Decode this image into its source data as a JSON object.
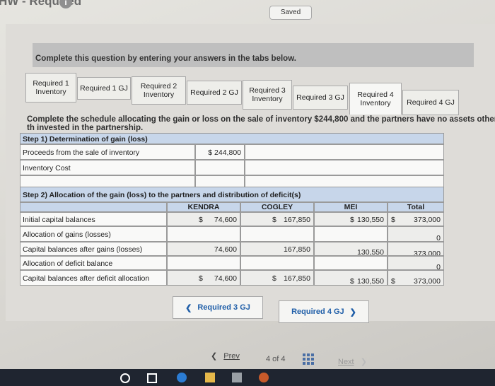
{
  "header": {
    "title": "HW - Required",
    "info_icon": "info-icon",
    "saved": "Saved"
  },
  "instruction": "Complete this question by entering your answers in the tabs below.",
  "tabs": [
    {
      "label": "Required 1 Inventory"
    },
    {
      "label": "Required 1 GJ"
    },
    {
      "label": "Required 2 Inventory"
    },
    {
      "label": "Required 2 GJ"
    },
    {
      "label": "Required 3 Inventory"
    },
    {
      "label": "Required 3 GJ"
    },
    {
      "label": "Required 4 Inventory"
    },
    {
      "label": "Required 4 GJ"
    }
  ],
  "schedule_text": "Complete the schedule allocating the gain or loss on the sale of inventory $244,800 and the partners have no assets other th invested in the partnership.",
  "step1": {
    "title": "Step 1) Determination of gain (loss)",
    "proceeds_label": "Proceeds from the sale of inventory",
    "proceeds_value": "$ 244,800",
    "inventory_cost_label": "Inventory Cost"
  },
  "step2": {
    "title": "Step 2) Allocation of the gain (loss) to the partners and distribution of deficit(s)",
    "columns": [
      "KENDRA",
      "COGLEY",
      "MEI",
      "Total"
    ],
    "rows": [
      {
        "label": "Initial capital balances",
        "kendra_cur": "$",
        "kendra": "74,600",
        "cogley_cur": "$",
        "cogley": "167,850",
        "mei_cur": "$",
        "mei": "130,550",
        "total_cur": "$",
        "total": "373,000"
      },
      {
        "label": "Allocation of gains (losses)",
        "total": "0"
      },
      {
        "label": "Capital balances after gains (losses)",
        "kendra": "74,600",
        "cogley": "167,850",
        "mei": "130,550",
        "total": "373,000"
      },
      {
        "label": "Allocation of deficit balance",
        "total": "0"
      },
      {
        "label": "Capital balances after deficit allocation",
        "kendra_cur": "$",
        "kendra": "74,600",
        "cogley_cur": "$",
        "cogley": "167,850",
        "mei_cur": "$",
        "mei": "130,550",
        "total_cur": "$",
        "total": "373,000"
      }
    ]
  },
  "nav": {
    "prev_tab": "Required 3 GJ",
    "next_tab": "Required 4 GJ"
  },
  "pager": {
    "prev": "Prev",
    "position": "4 of 4",
    "next": "Next"
  }
}
